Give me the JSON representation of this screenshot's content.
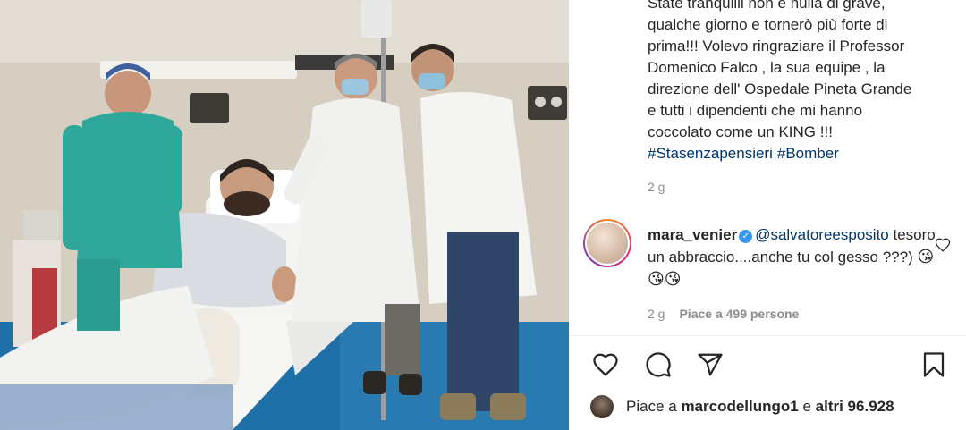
{
  "post": {
    "caption_lines": [
      "State tranquilli non è nulla di grave,",
      "qualche giorno e tornerò più forte di",
      "prima!!! Volevo ringraziare il Professor",
      "Domenico Falco , la sua equipe , la",
      "direzione dell' Ospedale Pineta Grande",
      "e tutti i dipendenti che mi hanno",
      "coccolato come un KING !!!"
    ],
    "hashtags": [
      "#Stasenzapensieri",
      "#Bomber"
    ],
    "caption_age": "2 g"
  },
  "comment": {
    "username": "mara_venier",
    "verified": true,
    "mention": "@salvatoreesposito",
    "text": "tesoro un abbraccio....anche tu col gesso ???)",
    "emojis": "😘😘😘",
    "age": "2 g",
    "likes": "Piace a 499 persone"
  },
  "actions": {
    "icons": [
      "heart-icon",
      "comment-icon",
      "share-icon",
      "bookmark-icon"
    ]
  },
  "likes_summary": {
    "prefix": "Piace a ",
    "user": "marcodellungo1",
    "middle": " e ",
    "others": "altri 96.928"
  },
  "colors": {
    "link": "#00376b",
    "muted": "#8e8e8e",
    "verified": "#3897f0",
    "scrub_green": "#2fa79a",
    "coat_white": "#f1f1ef"
  }
}
